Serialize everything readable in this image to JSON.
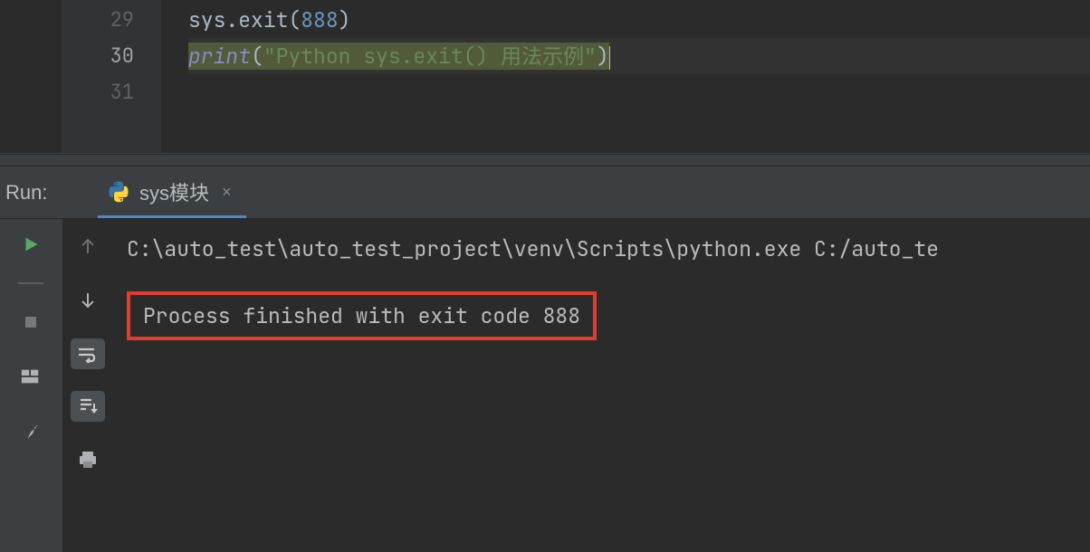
{
  "editor": {
    "lines": [
      {
        "num": "29",
        "active": false
      },
      {
        "num": "30",
        "active": true
      },
      {
        "num": "31",
        "active": false
      }
    ],
    "code29": {
      "fn": "sys.exit",
      "open": "(",
      "arg": "888",
      "close": ")"
    },
    "code30": {
      "fn": "print",
      "open": "(",
      "str": "\"Python sys.exit() 用法示例\"",
      "close": ")"
    }
  },
  "run": {
    "label": "Run:",
    "tab": {
      "name": "sys模块",
      "close": "×"
    },
    "console": {
      "path": "C:\\auto_test\\auto_test_project\\venv\\Scripts\\python.exe C:/auto_te",
      "result": "Process finished with exit code 888"
    }
  },
  "icons": {
    "run": "run-icon",
    "stop": "stop-icon",
    "layout": "layout-icon",
    "pin": "pin-icon",
    "up": "arrow-up-icon",
    "down": "arrow-down-icon",
    "wrap": "wrap-icon",
    "scroll": "scroll-to-end-icon",
    "print": "print-icon"
  }
}
